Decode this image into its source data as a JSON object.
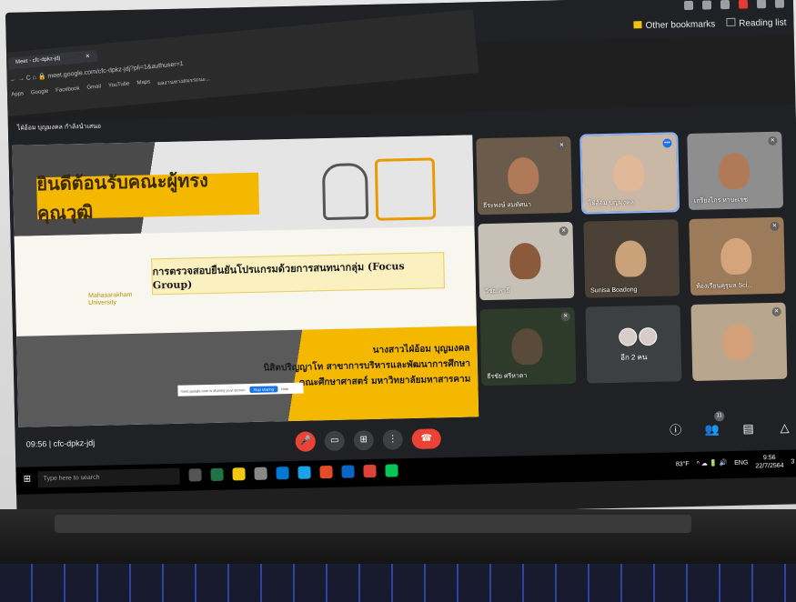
{
  "browser": {
    "tab_title": "Meet - cfc-dpkz-jdj",
    "address": "meet.google.com/cfc-dpkz-jdj?pli=1&authuser=1",
    "bookmarks_left": [
      "Apps",
      "Google",
      "Facebook",
      "Gmail",
      "YouTube",
      "Maps",
      "ผลงานทางสมรรถนะ..."
    ],
    "bookmarks_right": [
      "Other bookmarks",
      "Reading list"
    ]
  },
  "meet": {
    "presenter_label": "ไฝ่อ้อม บุญมงคล กำลังนำเสนอ",
    "time": "09:56",
    "meeting_code": "cfc-dpkz-jdj",
    "participants_count": "11"
  },
  "slide": {
    "welcome": "ยินดีต้อนรับคณะผู้ทรงคุณวุฒิ",
    "focus_title": "การตรวจสอบยืนยันโปรแกรมด้วยการสนทนากลุ่ม (Focus Group)",
    "university_line1": "Mahasarakham",
    "university_line2": "University",
    "presenter_line1": "นางสาวไฝ่อ้อม บุญมงคล",
    "presenter_line2": "นิสิตปริญญาโท สาขาการบริหารและพัฒนาการศึกษา",
    "presenter_line3": "คณะศึกษาศาสตร์ มหาวิทยาลัยมหาสารคาม",
    "share_notice": "meet.google.com is sharing your screen.",
    "stop_sharing": "Stop sharing",
    "hide": "Hide"
  },
  "tiles": [
    {
      "name": "ธีระพงษ์ สมทัศนา",
      "active": false
    },
    {
      "name": "ไฝ่อ้อม บุญมงคล",
      "active": true
    },
    {
      "name": "เกรียงไกร หาบะเรซ",
      "active": false
    },
    {
      "name": "วิชัย ลาธี",
      "active": false
    },
    {
      "name": "Sunisa Boadong",
      "active": false
    },
    {
      "name": "ห้องเรียนคุรุมล Sci...",
      "active": false
    },
    {
      "name": "ธีรชัย ศรีหาตา",
      "active": false
    },
    {
      "name": "อีก 2 คน",
      "active": false
    },
    {
      "name": "",
      "active": false
    }
  ],
  "taskbar": {
    "search_placeholder": "Type here to search",
    "weather": "83°F",
    "lang": "ENG",
    "time": "9:56",
    "date": "22/7/2564",
    "notifications": "3"
  }
}
